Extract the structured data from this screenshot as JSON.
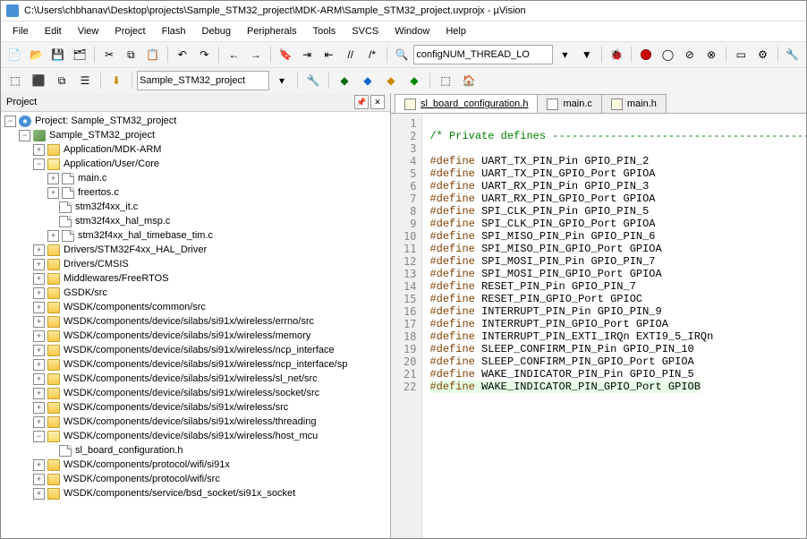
{
  "window": {
    "title": "C:\\Users\\chbhanav\\Desktop\\projects\\Sample_STM32_project\\MDK-ARM\\Sample_STM32_project.uvprojx - µVision"
  },
  "menu": [
    "File",
    "Edit",
    "View",
    "Project",
    "Flash",
    "Debug",
    "Peripherals",
    "Tools",
    "SVCS",
    "Window",
    "Help"
  ],
  "toolbar1": {
    "combo": "configNUM_THREAD_LO"
  },
  "toolbar2": {
    "target": "Sample_STM32_project"
  },
  "panel": {
    "title": "Project"
  },
  "tree": {
    "root": "Project: Sample_STM32_project",
    "app": "Sample_STM32_project",
    "g1": "Application/MDK-ARM",
    "g2": "Application/User/Core",
    "f1": "main.c",
    "f2": "freertos.c",
    "f3": "stm32f4xx_it.c",
    "f4": "stm32f4xx_hal_msp.c",
    "f5": "stm32f4xx_hal_timebase_tim.c",
    "g3": "Drivers/STM32F4xx_HAL_Driver",
    "g4": "Drivers/CMSIS",
    "g5": "Middlewares/FreeRTOS",
    "g6": "GSDK/src",
    "g7": "WSDK/components/common/src",
    "g8": "WSDK/components/device/silabs/si91x/wireless/errno/src",
    "g9": "WSDK/components/device/silabs/si91x/wireless/memory",
    "g10": "WSDK/components/device/silabs/si91x/wireless/ncp_interface",
    "g11": "WSDK/components/device/silabs/si91x/wireless/ncp_interface/sp",
    "g12": "WSDK/components/device/silabs/si91x/wireless/sl_net/src",
    "g13": "WSDK/components/device/silabs/si91x/wireless/socket/src",
    "g14": "WSDK/components/device/silabs/si91x/wireless/src",
    "g15": "WSDK/components/device/silabs/si91x/wireless/threading",
    "g16": "WSDK/components/device/silabs/si91x/wireless/host_mcu",
    "f6": "sl_board_configuration.h",
    "g17": "WSDK/components/protocol/wifi/si91x",
    "g18": "WSDK/components/protocol/wifi/src",
    "g19": "WSDK/components/service/bsd_socket/si91x_socket"
  },
  "tabs": [
    {
      "label": "sl_board_configuration.h",
      "active": true,
      "kind": "h"
    },
    {
      "label": "main.c",
      "active": false,
      "kind": "c"
    },
    {
      "label": "main.h",
      "active": false,
      "kind": "h"
    }
  ],
  "code": {
    "lines": [
      {
        "n": 1,
        "t": ""
      },
      {
        "n": 2,
        "t": "/* Private defines ------------------------------------------",
        "c": "comment"
      },
      {
        "n": 3,
        "t": ""
      },
      {
        "n": 4,
        "d": "#define",
        "t": " UART_TX_PIN_Pin GPIO_PIN_2"
      },
      {
        "n": 5,
        "d": "#define",
        "t": " UART_TX_PIN_GPIO_Port GPIOA"
      },
      {
        "n": 6,
        "d": "#define",
        "t": " UART_RX_PIN_Pin GPIO_PIN_3"
      },
      {
        "n": 7,
        "d": "#define",
        "t": " UART_RX_PIN_GPIO_Port GPIOA"
      },
      {
        "n": 8,
        "d": "#define",
        "t": " SPI_CLK_PIN_Pin GPIO_PIN_5"
      },
      {
        "n": 9,
        "d": "#define",
        "t": " SPI_CLK_PIN_GPIO_Port GPIOA"
      },
      {
        "n": 10,
        "d": "#define",
        "t": " SPI_MISO_PIN_Pin GPIO_PIN_6"
      },
      {
        "n": 11,
        "d": "#define",
        "t": " SPI_MISO_PIN_GPIO_Port GPIOA"
      },
      {
        "n": 12,
        "d": "#define",
        "t": " SPI_MOSI_PIN_Pin GPIO_PIN_7"
      },
      {
        "n": 13,
        "d": "#define",
        "t": " SPI_MOSI_PIN_GPIO_Port GPIOA"
      },
      {
        "n": 14,
        "d": "#define",
        "t": " RESET_PIN_Pin GPIO_PIN_7"
      },
      {
        "n": 15,
        "d": "#define",
        "t": " RESET_PIN_GPIO_Port GPIOC"
      },
      {
        "n": 16,
        "d": "#define",
        "t": " INTERRUPT_PIN_Pin GPIO_PIN_9"
      },
      {
        "n": 17,
        "d": "#define",
        "t": " INTERRUPT_PIN_GPIO_Port GPIOA"
      },
      {
        "n": 18,
        "d": "#define",
        "t": " INTERRUPT_PIN_EXTI_IRQn EXTI9_5_IRQn"
      },
      {
        "n": 19,
        "d": "#define",
        "t": " SLEEP_CONFIRM_PIN_Pin GPIO_PIN_10"
      },
      {
        "n": 20,
        "d": "#define",
        "t": " SLEEP_CONFIRM_PIN_GPIO_Port GPIOA"
      },
      {
        "n": 21,
        "d": "#define",
        "t": " WAKE_INDICATOR_PIN_Pin GPIO_PIN_5"
      },
      {
        "n": 22,
        "d": "#define",
        "t": " WAKE_INDICATOR_PIN_GPIO_Port GPIOB",
        "hl": true
      }
    ]
  }
}
